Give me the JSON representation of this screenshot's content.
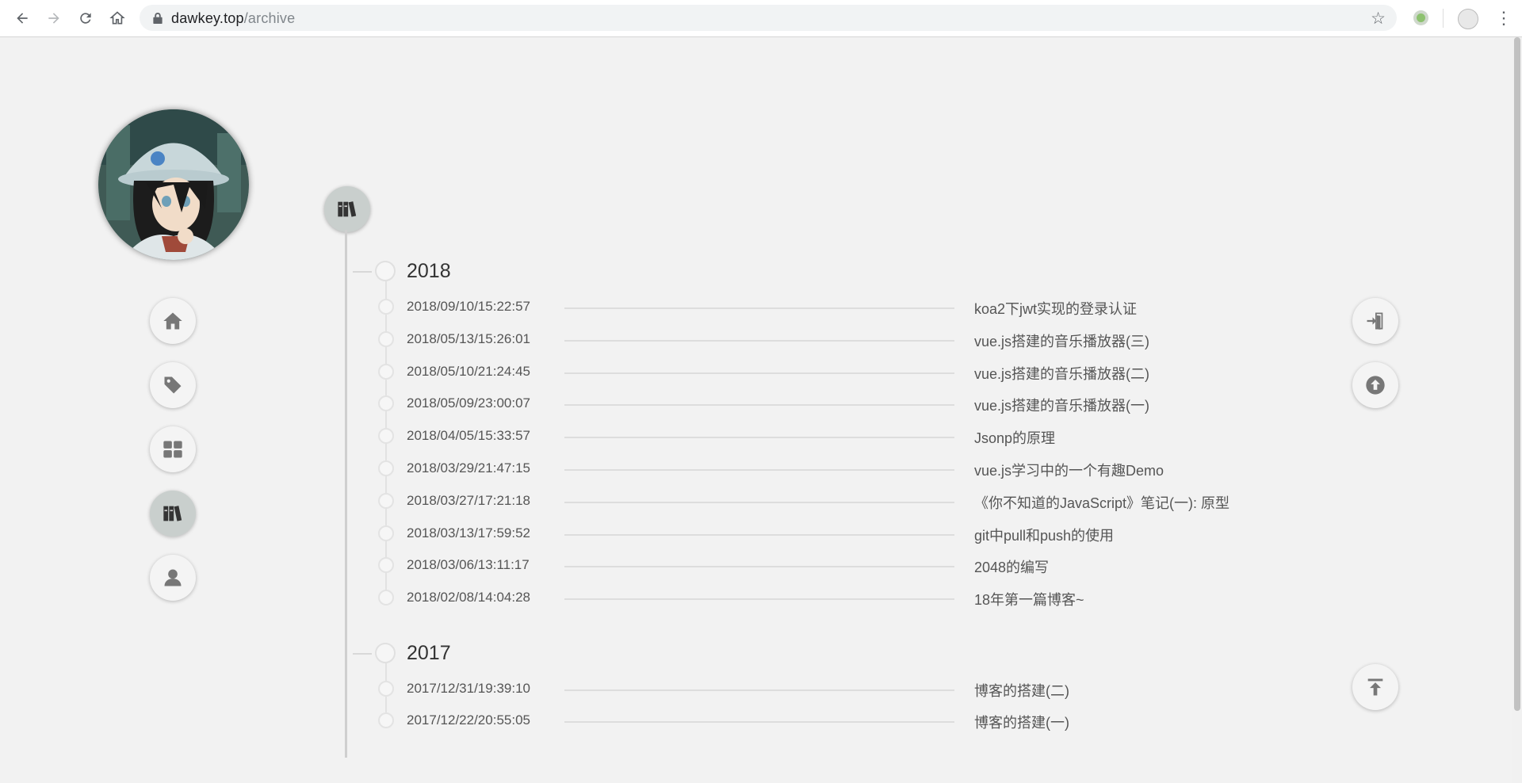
{
  "browser": {
    "url_domain": "dawkey.top",
    "url_path": "/archive",
    "icons": [
      "back-icon",
      "forward-icon",
      "reload-icon",
      "home-icon",
      "lock-icon",
      "star-icon",
      "extension-icon",
      "profile-icon",
      "menu-icon"
    ]
  },
  "sidebar": {
    "items": [
      {
        "name": "home",
        "icon": "home-icon"
      },
      {
        "name": "tags",
        "icon": "tag-icon"
      },
      {
        "name": "categories",
        "icon": "grid-icon"
      },
      {
        "name": "archive",
        "icon": "books-icon",
        "active": true
      },
      {
        "name": "about",
        "icon": "user-icon"
      }
    ]
  },
  "timeline": {
    "header_icon": "books-icon",
    "years": [
      {
        "year": "2018",
        "posts": [
          {
            "date": "2018/09/10/15:22:57",
            "title": "koa2下jwt实现的登录认证"
          },
          {
            "date": "2018/05/13/15:26:01",
            "title": "vue.js搭建的音乐播放器(三)"
          },
          {
            "date": "2018/05/10/21:24:45",
            "title": "vue.js搭建的音乐播放器(二)"
          },
          {
            "date": "2018/05/09/23:00:07",
            "title": "vue.js搭建的音乐播放器(一)"
          },
          {
            "date": "2018/04/05/15:33:57",
            "title": "Jsonp的原理"
          },
          {
            "date": "2018/03/29/21:47:15",
            "title": "vue.js学习中的一个有趣Demo"
          },
          {
            "date": "2018/03/27/17:21:18",
            "title": "《你不知道的JavaScript》笔记(一): 原型"
          },
          {
            "date": "2018/03/13/17:59:52",
            "title": "git中pull和push的使用"
          },
          {
            "date": "2018/03/06/13:11:17",
            "title": "2048的编写"
          },
          {
            "date": "2018/02/08/14:04:28",
            "title": "18年第一篇博客~"
          }
        ]
      },
      {
        "year": "2017",
        "posts": [
          {
            "date": "2017/12/31/19:39:10",
            "title": "博客的搭建(二)"
          },
          {
            "date": "2017/12/22/20:55:05",
            "title": "博客的搭建(一)"
          }
        ]
      }
    ]
  },
  "right_buttons": [
    {
      "name": "logout",
      "icon": "exit-door-icon"
    },
    {
      "name": "upload",
      "icon": "arrow-up-circle-icon"
    },
    {
      "name": "back-to-top",
      "icon": "to-top-icon"
    }
  ],
  "colors": {
    "background": "#f2f2f2",
    "active_button": "#c9cfcd",
    "icon": "#777777",
    "timeline_line": "#cfcfcf"
  }
}
